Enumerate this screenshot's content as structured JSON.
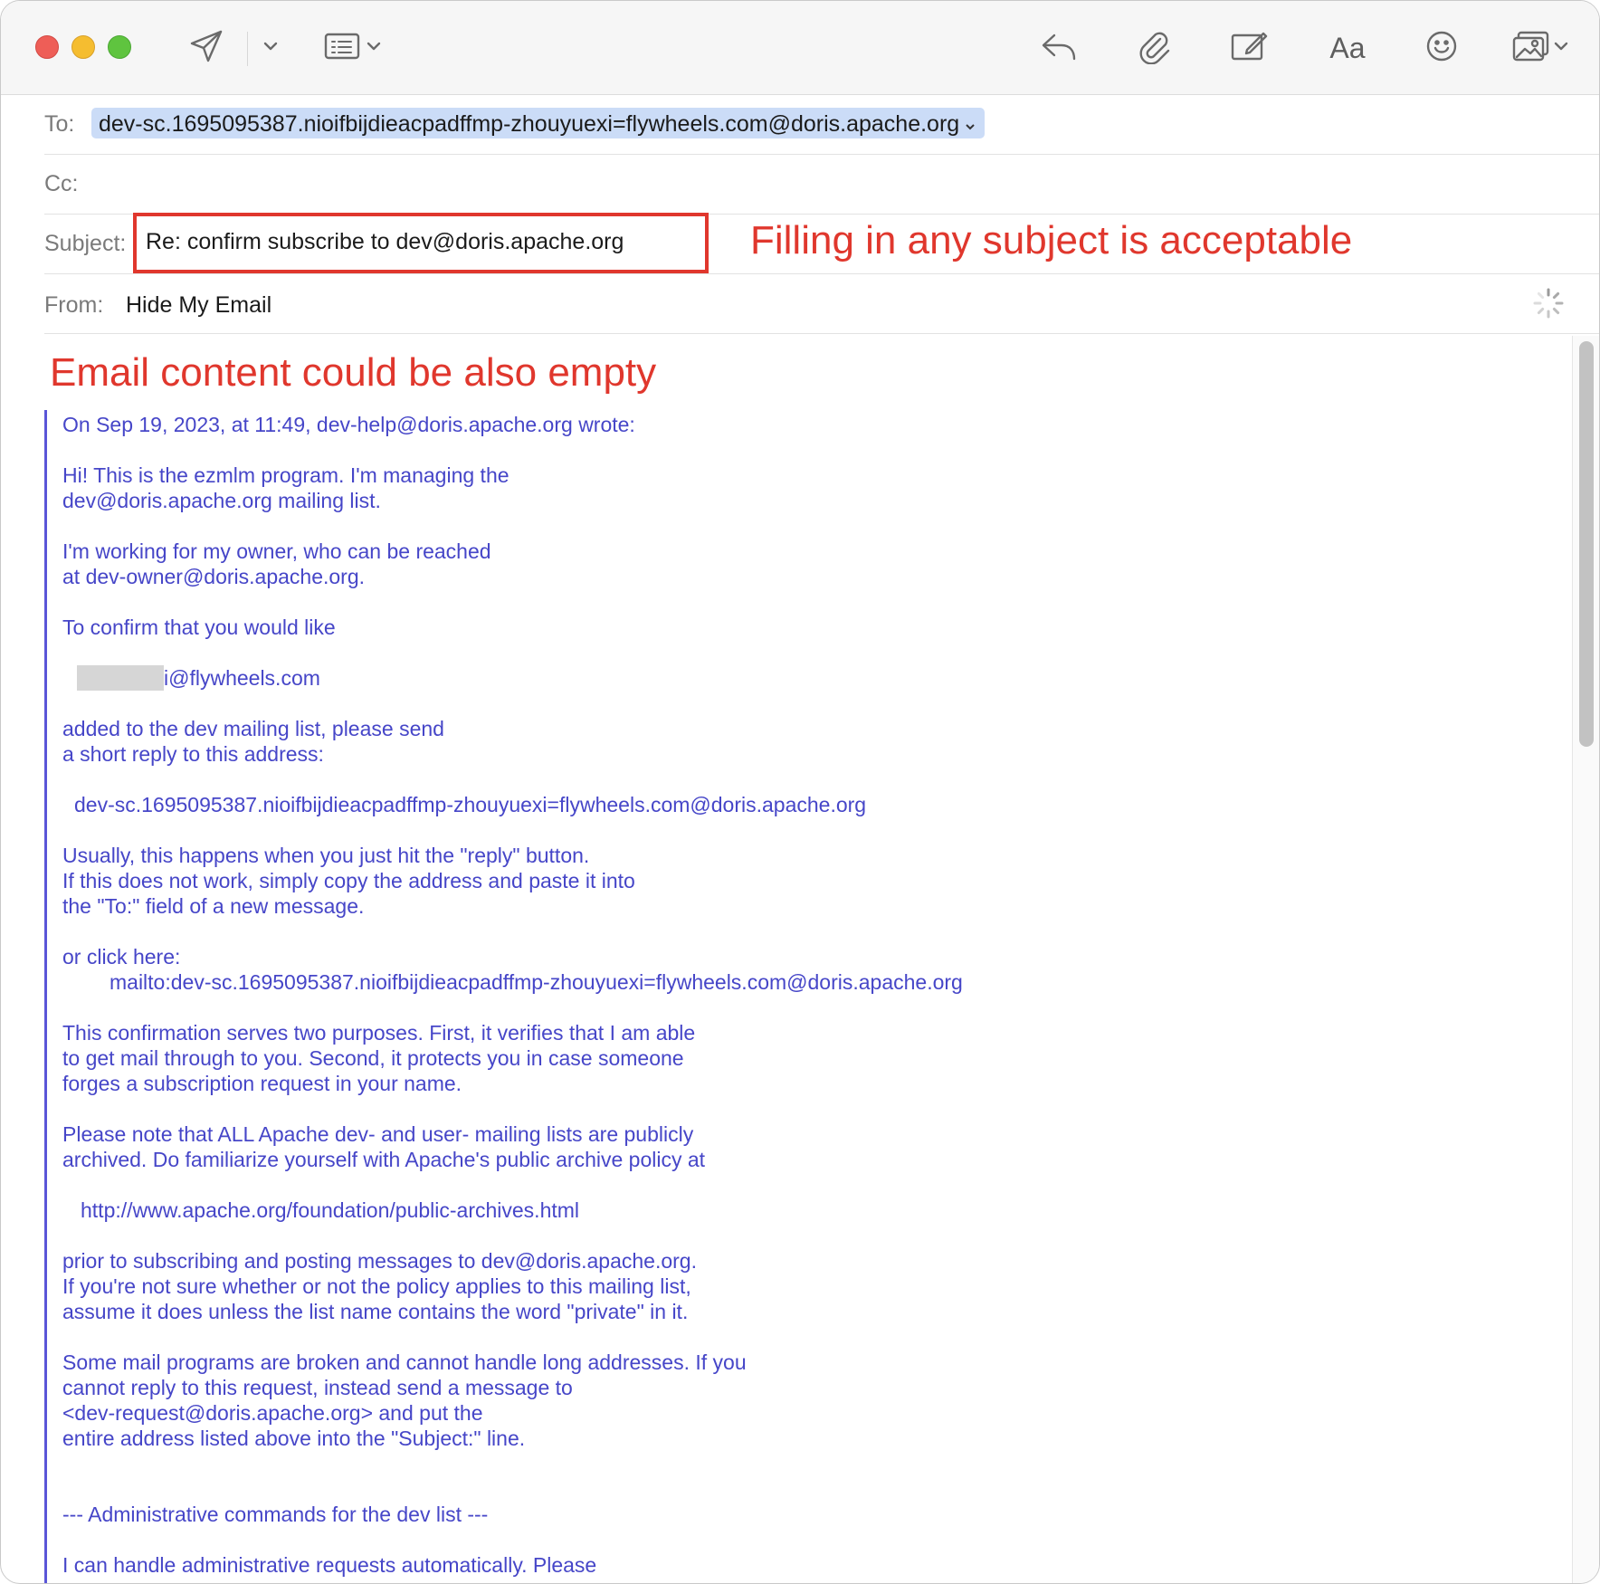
{
  "toolbar": {
    "send_icon": "paper-plane-icon",
    "send_menu_icon": "chevron-down-icon",
    "header_fields_icon": "list-icon",
    "reply_icon": "reply-arrow-icon",
    "attach_icon": "paperclip-icon",
    "markup_icon": "compose-icon",
    "format_label": "Aa",
    "emoji_icon": "smiley-icon",
    "photo_icon": "photo-icon"
  },
  "header": {
    "to_label": "To:",
    "to_value": "dev-sc.1695095387.nioifbijdieacpadffmp-zhouyuexi=flywheels.com@doris.apache.org",
    "cc_label": "Cc:",
    "subject_label": "Subject:",
    "subject_value": "Re: confirm subscribe to dev@doris.apache.org",
    "from_label": "From:",
    "from_value": "Hide My Email"
  },
  "annotations": {
    "subject_note": "Filling in any subject is acceptable",
    "body_note": "Email content could be also empty"
  },
  "colors": {
    "annotation_red": "#e0372d",
    "quote_text": "#4646c8",
    "quote_bar": "#5a55d8",
    "token_bg": "#cbdcf7"
  },
  "body": {
    "lines": [
      "On Sep 19, 2023, at 11:49, dev-help@doris.apache.org wrote:",
      "Hi! This is the ezmlm program. I'm managing the",
      "dev@doris.apache.org mailing list.",
      "I'm working for my owner, who can be reached",
      "at dev-owner@doris.apache.org.",
      "To confirm that you would like",
      "i@flywheels.com",
      "added to the dev mailing list, please send",
      "a short reply to this address:",
      "dev-sc.1695095387.nioifbijdieacpadffmp-zhouyuexi=flywheels.com@doris.apache.org",
      "Usually, this happens when you just hit the \"reply\" button.",
      "If this does not work, simply copy the address and paste it into",
      "the \"To:\" field of a new message.",
      "or click here:",
      "mailto:dev-sc.1695095387.nioifbijdieacpadffmp-zhouyuexi=flywheels.com@doris.apache.org",
      "This confirmation serves two purposes. First, it verifies that I am able",
      "to get mail through to you. Second, it protects you in case someone",
      "forges a subscription request in your name.",
      "Please note that ALL Apache dev- and user- mailing lists are publicly",
      "archived.  Do familiarize yourself with Apache's public archive policy at",
      "http://www.apache.org/foundation/public-archives.html",
      "prior to subscribing and posting messages to dev@doris.apache.org.",
      "If you're not sure whether or not the policy applies to this mailing list,",
      "assume it does unless the list name contains the word \"private\" in it.",
      "Some mail programs are broken and cannot handle long addresses. If you",
      "cannot reply to this request, instead send a message to",
      "<dev-request@doris.apache.org> and put the",
      "entire address listed above into the \"Subject:\" line.",
      "--- Administrative commands for the dev list ---",
      "I can handle administrative requests automatically. Please"
    ]
  }
}
